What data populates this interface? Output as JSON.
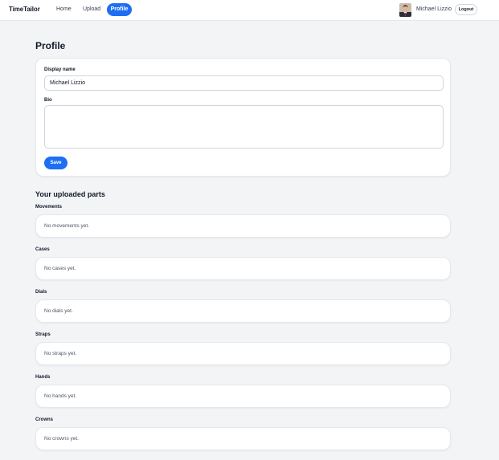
{
  "navbar": {
    "brand": "TimeTailor",
    "links": [
      {
        "label": "Home",
        "active": false
      },
      {
        "label": "Upload",
        "active": false
      },
      {
        "label": "Profile",
        "active": true
      }
    ],
    "user_name": "Michael Lizzio",
    "logout_label": "Logout"
  },
  "profile": {
    "title": "Profile",
    "display_name_label": "Display name",
    "display_name_value": "Michael Lizzio",
    "bio_label": "Bio",
    "bio_value": "",
    "save_label": "Save"
  },
  "uploads": {
    "title": "Your uploaded parts",
    "groups": [
      {
        "label": "Movements",
        "empty_text": "No movements yet."
      },
      {
        "label": "Cases",
        "empty_text": "No cases yet."
      },
      {
        "label": "Dials",
        "empty_text": "No dials yet."
      },
      {
        "label": "Straps",
        "empty_text": "No straps yet."
      },
      {
        "label": "Hands",
        "empty_text": "No hands yet."
      },
      {
        "label": "Crowns",
        "empty_text": "No crowns yet."
      }
    ]
  },
  "colors": {
    "accent": "#1d6ef2",
    "background": "#f3f4f6",
    "card": "#ffffff"
  }
}
